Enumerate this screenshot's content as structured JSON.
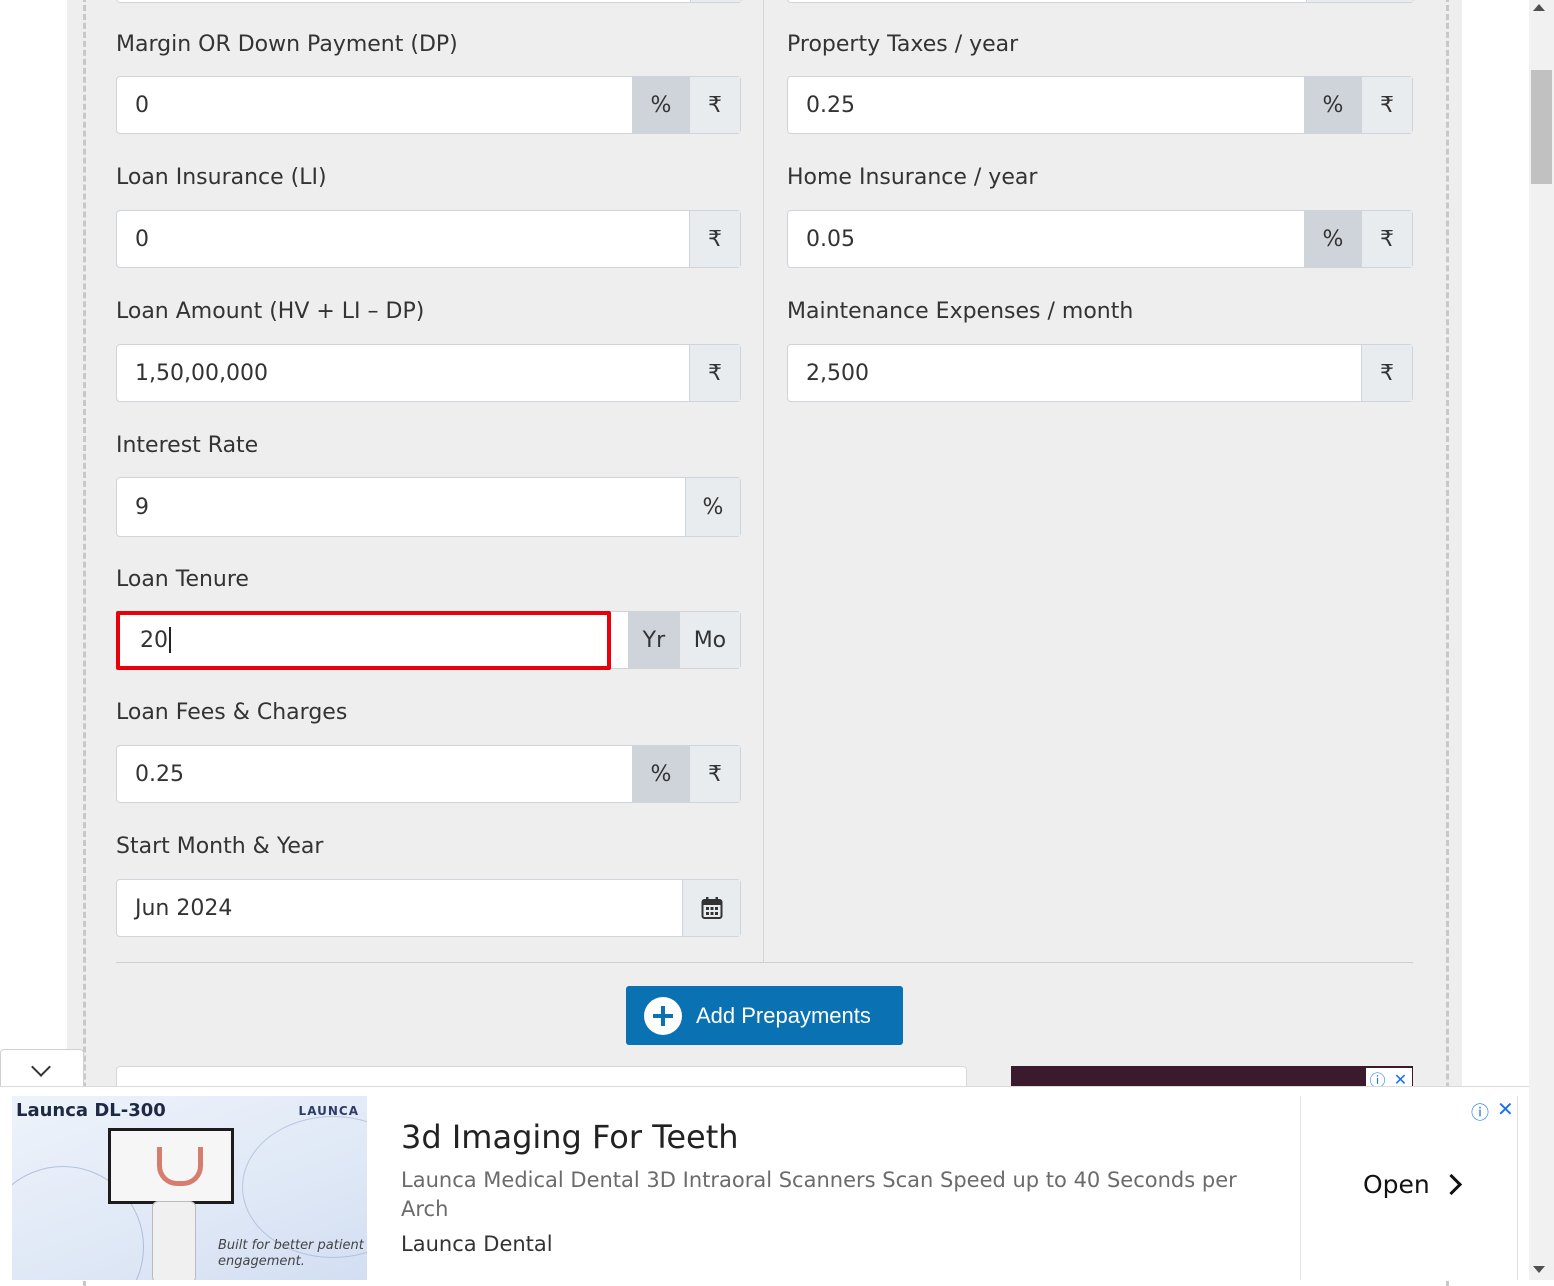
{
  "left_fields": {
    "down_payment": {
      "label": "Margin OR Down Payment (DP)",
      "value": "0",
      "addon_percent": "%",
      "addon_rupee": "₹"
    },
    "loan_insurance": {
      "label": "Loan Insurance (LI)",
      "value": "0",
      "addon_rupee": "₹"
    },
    "loan_amount": {
      "label": "Loan Amount (HV + LI – DP)",
      "value": "1,50,00,000",
      "addon_rupee": "₹"
    },
    "interest_rate": {
      "label": "Interest Rate",
      "value": "9",
      "addon_percent": "%"
    },
    "loan_tenure": {
      "label": "Loan Tenure",
      "value": "20",
      "addon_year": "Yr",
      "addon_month": "Mo"
    },
    "loan_fees": {
      "label": "Loan Fees & Charges",
      "value": "0.25",
      "addon_percent": "%",
      "addon_rupee": "₹"
    },
    "start_date": {
      "label": "Start Month & Year",
      "value": "Jun 2024",
      "icon": "calendar-icon"
    }
  },
  "right_fields": {
    "property_taxes": {
      "label": "Property Taxes / year",
      "value": "0.25",
      "addon_percent": "%",
      "addon_rupee": "₹"
    },
    "home_insurance": {
      "label": "Home Insurance / year",
      "value": "0.05",
      "addon_percent": "%",
      "addon_rupee": "₹"
    },
    "maintenance": {
      "label": "Maintenance Expenses / month",
      "value": "2,500",
      "addon_rupee": "₹"
    }
  },
  "prepayments_button": {
    "label": "Add Prepayments",
    "icon": "plus-circle-icon"
  },
  "ad": {
    "brand_left": "Launca DL-300",
    "brand_right": "LAUNCA",
    "tagline": "Built for better patient engagement.",
    "title": "3d Imaging For Teeth",
    "description": "Launca Medical Dental 3D Intraoral Scanners Scan Speed up to 40 Seconds per Arch",
    "advertiser": "Launca Dental",
    "cta": "Open",
    "info_glyph": "ⓘ",
    "close_glyph": "✕"
  },
  "colors": {
    "accent": "#0a72b2",
    "focus_border": "#e8000b",
    "page_bg": "#eeeeee"
  }
}
